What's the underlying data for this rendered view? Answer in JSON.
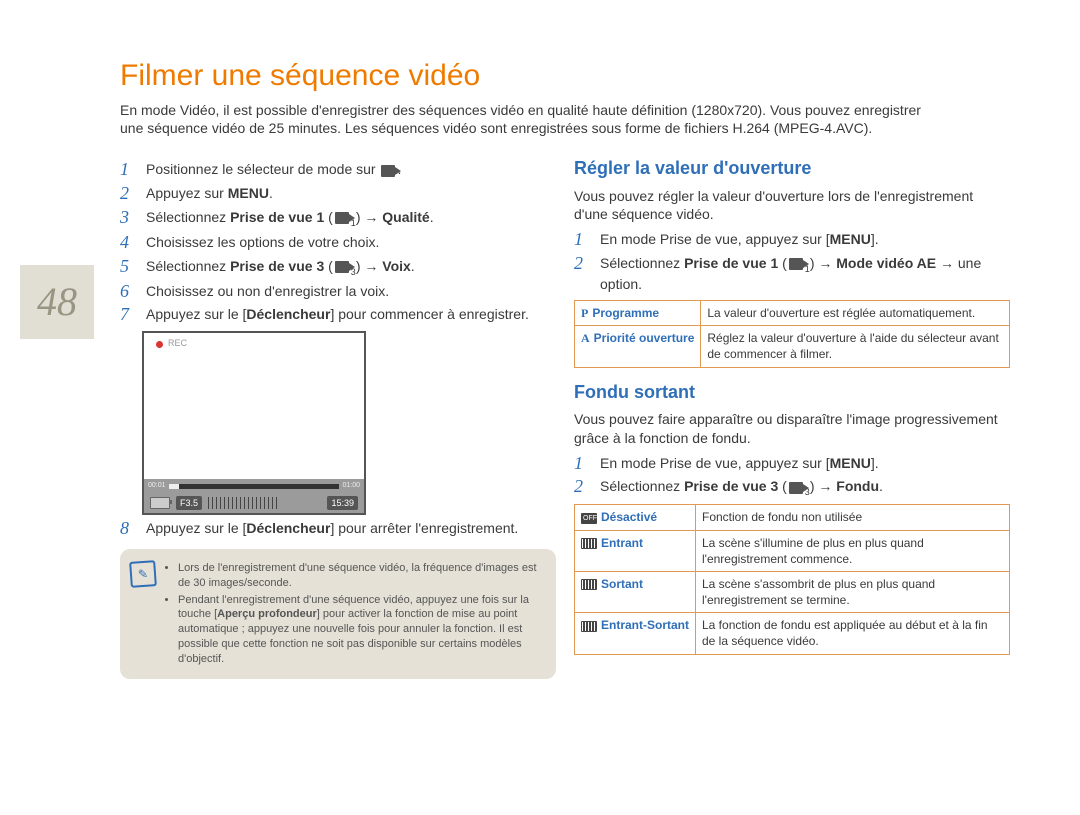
{
  "page_number": "48",
  "title": "Filmer une séquence vidéo",
  "intro": "En mode Vidéo, il est possible d'enregistrer des séquences vidéo en qualité haute définition (1280x720). Vous pouvez enregistrer une séquence vidéo de 25 minutes. Les séquences vidéo sont enregistrées sous forme de fichiers H.264 (MPEG-4.AVC).",
  "left_steps": {
    "s1": "Positionnez le sélecteur de mode sur ",
    "s2_pre": "Appuyez sur ",
    "s2_b": "MENU",
    "s2_post": ".",
    "s3_pre": "Sélectionnez ",
    "s3_b": "Prise de vue 1",
    "s3_mid": " (",
    "s3_sub": "1",
    "s3_arrow": ") → ",
    "s3_b2": "Qualité",
    "s3_post": ".",
    "s4": "Choisissez les options de votre choix.",
    "s5_pre": "Sélectionnez ",
    "s5_b": "Prise de vue 3",
    "s5_mid": " (",
    "s5_sub": "3",
    "s5_arrow": ") → ",
    "s5_b2": "Voix",
    "s5_post": ".",
    "s6": "Choisissez ou non d'enregistrer la voix.",
    "s7_pre": "Appuyez sur le ",
    "s7_b": "Déclencheur",
    "s7_post": " pour commencer à enregistrer.",
    "s8_pre": "Appuyez sur le ",
    "s8_b": "Déclencheur",
    "s8_post": " pour arrêter l'enregistrement."
  },
  "preview": {
    "rec": "REC",
    "time_a": "00:01",
    "time_b": "01:00",
    "fnum": "F3.5",
    "clock": "15:39"
  },
  "notes": {
    "n1": "Lors de l'enregistrement d'une séquence vidéo, la fréquence d'images est de 30 images/seconde.",
    "n2_pre": "Pendant l'enregistrement d'une séquence vidéo, appuyez une fois sur la touche ",
    "n2_b": "Aperçu profondeur",
    "n2_post": " pour activer la fonction de mise au point automatique ; appuyez une nouvelle fois pour annuler la fonction. Il est possible que cette fonction ne soit pas disponible sur certains modèles d'objectif."
  },
  "aperture": {
    "title": "Régler la valeur d'ouverture",
    "desc": "Vous pouvez régler la valeur d'ouverture lors de l'enregistrement d'une séquence vidéo.",
    "s1_pre": "En mode Prise de vue, appuyez sur ",
    "s1_b": "MENU",
    "s1_post": ".",
    "s2_pre": "Sélectionnez ",
    "s2_b": "Prise de vue 1",
    "s2_mid": " (",
    "s2_sub": "1",
    "s2_arrow": ") → ",
    "s2_b2": "Mode vidéo AE",
    "s2_post": " → une option.",
    "t_prog_label": "Programme",
    "t_prog_desc": "La valeur d'ouverture est réglée automatiquement.",
    "t_prio_label": "Priorité ouverture",
    "t_prio_desc": "Réglez la valeur d'ouverture à l'aide du sélecteur avant de commencer à filmer."
  },
  "fondu": {
    "title": "Fondu sortant",
    "desc": "Vous pouvez faire apparaître ou disparaître l'image progressivement grâce à la fonction de fondu.",
    "s1_pre": "En mode Prise de vue, appuyez sur ",
    "s1_b": "MENU",
    "s1_post": ".",
    "s2_pre": "Sélectionnez ",
    "s2_b": "Prise de vue 3",
    "s2_mid": " (",
    "s2_sub": "3",
    "s2_arrow": ") → ",
    "s2_b2": "Fondu",
    "s2_post": ".",
    "t_off_label": "Désactivé",
    "t_off_desc": "Fonction de fondu non utilisée",
    "t_in_label": "Entrant",
    "t_in_desc": "La scène s'illumine de plus en plus quand l'enregistrement commence.",
    "t_out_label": "Sortant",
    "t_out_desc": "La scène s'assombrit de plus en plus quand l'enregistrement se termine.",
    "t_io_label": "Entrant-Sortant",
    "t_io_desc": "La fonction de fondu est appliquée au début et à la fin de la séquence vidéo."
  }
}
